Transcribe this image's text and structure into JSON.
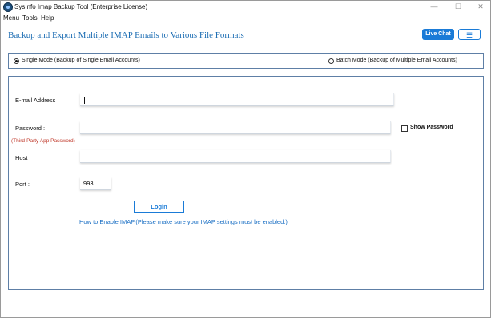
{
  "window": {
    "title": "SysInfo Imap Backup Tool (Enterprise License)",
    "controls": {
      "minimize": "—",
      "maximize": "☐",
      "close": "✕"
    }
  },
  "menubar": {
    "items": [
      "Menu",
      "Tools",
      "Help"
    ]
  },
  "header": {
    "title": "Backup and Export Multiple IMAP Emails to Various File Formats",
    "live_chat": "Live Chat",
    "menu_icon": "☰"
  },
  "modes": {
    "single": "Single Mode (Backup of Single Email Accounts)",
    "batch": "Batch Mode (Backup of Multiple Email Accounts)",
    "selected": "single"
  },
  "form": {
    "email_label": "E-mail Address :",
    "email_value": "",
    "password_label": "Password :",
    "password_hint": "(Third-Party App Password)",
    "password_value": "",
    "show_password": "Show Password",
    "host_label": "Host :",
    "host_value": "",
    "port_label": "Port :",
    "port_value": "993",
    "login": "Login",
    "imap_help": "How to Enable IMAP.(Please make sure your IMAP settings must be enabled.)"
  },
  "colors": {
    "accent": "#1a7bd7",
    "title": "#1f6fb4",
    "hint": "#c0392b",
    "border": "#5e7fa6"
  }
}
